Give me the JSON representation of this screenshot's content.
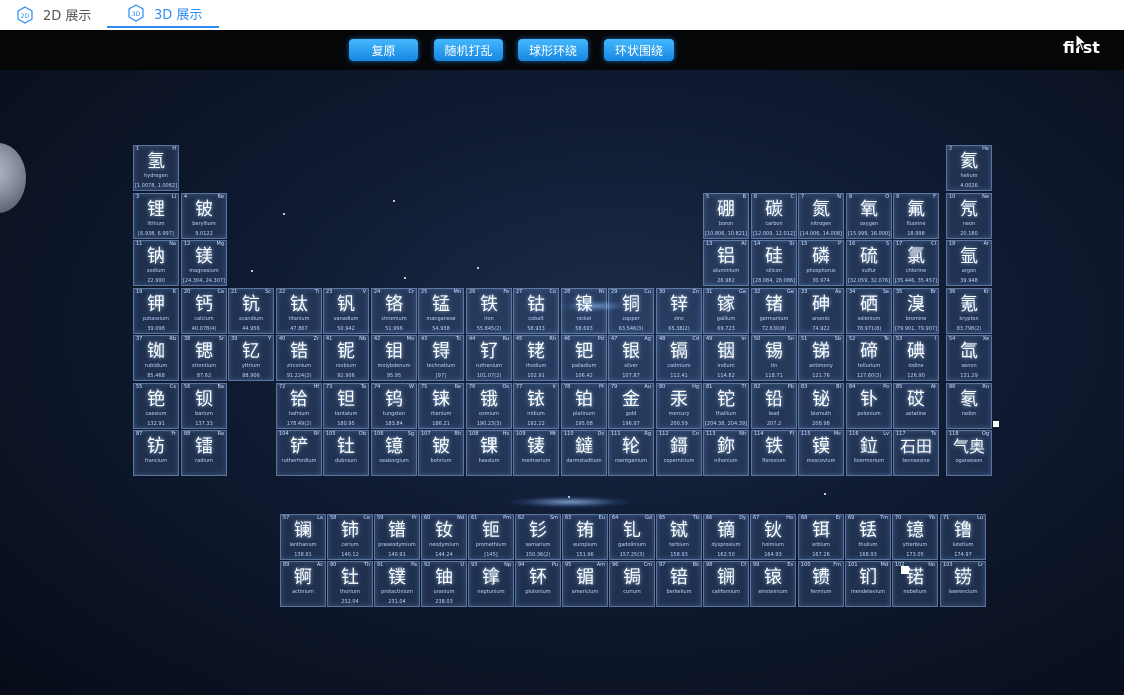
{
  "tabs": [
    {
      "label": "2D 展示",
      "icon_text": "2D",
      "icon": "cube-2d-icon"
    },
    {
      "label": "3D 展示",
      "icon_text": "3D",
      "icon": "cube-3d-icon",
      "active": true
    }
  ],
  "toolbar": {
    "buttons": [
      "复原",
      "随机打乱",
      "球形环绕",
      "环状围绕"
    ]
  },
  "scene_label": "first",
  "colors": {
    "accent": "#2d8cf0",
    "button": "#1686e0",
    "background": "#0b1426",
    "tile_border": "#a0c8ff"
  },
  "elements": [
    {
      "num": "1",
      "sym": "H",
      "name": "氢",
      "en": "hydrogen",
      "mass": "[1.0078, 1.0082]"
    },
    {
      "num": "2",
      "sym": "He",
      "name": "氦",
      "en": "helium",
      "mass": "4.0026"
    },
    {
      "num": "3",
      "sym": "Li",
      "name": "锂",
      "en": "lithium",
      "mass": "[6.938, 6.997]"
    },
    {
      "num": "4",
      "sym": "Be",
      "name": "铍",
      "en": "beryllium",
      "mass": "9.0122"
    },
    {
      "num": "5",
      "sym": "B",
      "name": "硼",
      "en": "boron",
      "mass": "[10.806, 10.821]"
    },
    {
      "num": "6",
      "sym": "C",
      "name": "碳",
      "en": "carbon",
      "mass": "[12.009, 12.012]"
    },
    {
      "num": "7",
      "sym": "N",
      "name": "氮",
      "en": "nitrogen",
      "mass": "[14.006, 14.008]"
    },
    {
      "num": "8",
      "sym": "O",
      "name": "氧",
      "en": "oxygen",
      "mass": "[15.999, 16.000]"
    },
    {
      "num": "9",
      "sym": "F",
      "name": "氟",
      "en": "fluorine",
      "mass": "18.998"
    },
    {
      "num": "10",
      "sym": "Ne",
      "name": "氖",
      "en": "neon",
      "mass": "20.180"
    },
    {
      "num": "11",
      "sym": "Na",
      "name": "钠",
      "en": "sodium",
      "mass": "22.990"
    },
    {
      "num": "12",
      "sym": "Mg",
      "name": "镁",
      "en": "magnesium",
      "mass": "[24.304, 24.307]"
    },
    {
      "num": "13",
      "sym": "Al",
      "name": "铝",
      "en": "aluminium",
      "mass": "26.982"
    },
    {
      "num": "14",
      "sym": "Si",
      "name": "硅",
      "en": "silicon",
      "mass": "[28.084, 28.086]"
    },
    {
      "num": "15",
      "sym": "P",
      "name": "磷",
      "en": "phosphorus",
      "mass": "30.974"
    },
    {
      "num": "16",
      "sym": "S",
      "name": "硫",
      "en": "sulfur",
      "mass": "[32.059, 32.076]"
    },
    {
      "num": "17",
      "sym": "Cl",
      "name": "氯",
      "en": "chlorine",
      "mass": "[35.446, 35.457]"
    },
    {
      "num": "18",
      "sym": "Ar",
      "name": "氩",
      "en": "argon",
      "mass": "39.948"
    },
    {
      "num": "19",
      "sym": "K",
      "name": "钾",
      "en": "potassium",
      "mass": "39.098"
    },
    {
      "num": "20",
      "sym": "Ca",
      "name": "钙",
      "en": "calcium",
      "mass": "40.078(4)"
    },
    {
      "num": "21",
      "sym": "Sc",
      "name": "钪",
      "en": "scandium",
      "mass": "44.956"
    },
    {
      "num": "22",
      "sym": "Ti",
      "name": "钛",
      "en": "titanium",
      "mass": "47.867"
    },
    {
      "num": "23",
      "sym": "V",
      "name": "钒",
      "en": "vanadium",
      "mass": "50.942"
    },
    {
      "num": "24",
      "sym": "Cr",
      "name": "铬",
      "en": "chromium",
      "mass": "51.996"
    },
    {
      "num": "25",
      "sym": "Mn",
      "name": "锰",
      "en": "manganese",
      "mass": "54.938"
    },
    {
      "num": "26",
      "sym": "Fe",
      "name": "铁",
      "en": "iron",
      "mass": "55.845(2)"
    },
    {
      "num": "27",
      "sym": "Co",
      "name": "钴",
      "en": "cobalt",
      "mass": "58.933"
    },
    {
      "num": "28",
      "sym": "Ni",
      "name": "镍",
      "en": "nickel",
      "mass": "58.693"
    },
    {
      "num": "29",
      "sym": "Cu",
      "name": "铜",
      "en": "copper",
      "mass": "63.546(3)"
    },
    {
      "num": "30",
      "sym": "Zn",
      "name": "锌",
      "en": "zinc",
      "mass": "65.38(2)"
    },
    {
      "num": "31",
      "sym": "Ga",
      "name": "镓",
      "en": "gallium",
      "mass": "69.723"
    },
    {
      "num": "32",
      "sym": "Ge",
      "name": "锗",
      "en": "germanium",
      "mass": "72.630(8)"
    },
    {
      "num": "33",
      "sym": "As",
      "name": "砷",
      "en": "arsenic",
      "mass": "74.922"
    },
    {
      "num": "34",
      "sym": "Se",
      "name": "硒",
      "en": "selenium",
      "mass": "78.971(8)"
    },
    {
      "num": "35",
      "sym": "Br",
      "name": "溴",
      "en": "bromine",
      "mass": "[79.901, 79.907]"
    },
    {
      "num": "36",
      "sym": "Kr",
      "name": "氪",
      "en": "krypton",
      "mass": "83.798(2)"
    },
    {
      "num": "37",
      "sym": "Rb",
      "name": "铷",
      "en": "rubidium",
      "mass": "85.468"
    },
    {
      "num": "38",
      "sym": "Sr",
      "name": "锶",
      "en": "strontium",
      "mass": "87.62"
    },
    {
      "num": "39",
      "sym": "Y",
      "name": "钇",
      "en": "yttrium",
      "mass": "88.906"
    },
    {
      "num": "40",
      "sym": "Zr",
      "name": "锆",
      "en": "zirconium",
      "mass": "91.224(2)"
    },
    {
      "num": "41",
      "sym": "Nb",
      "name": "铌",
      "en": "niobium",
      "mass": "92.906"
    },
    {
      "num": "42",
      "sym": "Mo",
      "name": "钼",
      "en": "molybdenum",
      "mass": "95.95"
    },
    {
      "num": "43",
      "sym": "Tc",
      "name": "锝",
      "en": "technetium",
      "mass": "[97]"
    },
    {
      "num": "44",
      "sym": "Ru",
      "name": "钌",
      "en": "ruthenium",
      "mass": "101.07(2)"
    },
    {
      "num": "45",
      "sym": "Rh",
      "name": "铑",
      "en": "rhodium",
      "mass": "102.91"
    },
    {
      "num": "46",
      "sym": "Pd",
      "name": "钯",
      "en": "palladium",
      "mass": "106.42"
    },
    {
      "num": "47",
      "sym": "Ag",
      "name": "银",
      "en": "silver",
      "mass": "107.87"
    },
    {
      "num": "48",
      "sym": "Cd",
      "name": "镉",
      "en": "cadmium",
      "mass": "112.41"
    },
    {
      "num": "49",
      "sym": "In",
      "name": "铟",
      "en": "indium",
      "mass": "114.82"
    },
    {
      "num": "50",
      "sym": "Sn",
      "name": "锡",
      "en": "tin",
      "mass": "118.71"
    },
    {
      "num": "51",
      "sym": "Sb",
      "name": "锑",
      "en": "antimony",
      "mass": "121.76"
    },
    {
      "num": "52",
      "sym": "Te",
      "name": "碲",
      "en": "tellurium",
      "mass": "127.60(3)"
    },
    {
      "num": "53",
      "sym": "I",
      "name": "碘",
      "en": "iodine",
      "mass": "126.90"
    },
    {
      "num": "54",
      "sym": "Xe",
      "name": "氙",
      "en": "xenon",
      "mass": "131.29"
    },
    {
      "num": "55",
      "sym": "Cs",
      "name": "铯",
      "en": "caesium",
      "mass": "132.91"
    },
    {
      "num": "56",
      "sym": "Ba",
      "name": "钡",
      "en": "barium",
      "mass": "137.33"
    },
    {
      "num": "72",
      "sym": "Hf",
      "name": "铪",
      "en": "hafnium",
      "mass": "178.49(2)"
    },
    {
      "num": "73",
      "sym": "Ta",
      "name": "钽",
      "en": "tantalum",
      "mass": "180.95"
    },
    {
      "num": "74",
      "sym": "W",
      "name": "钨",
      "en": "tungsten",
      "mass": "183.84"
    },
    {
      "num": "75",
      "sym": "Re",
      "name": "铼",
      "en": "rhenium",
      "mass": "186.21"
    },
    {
      "num": "76",
      "sym": "Os",
      "name": "锇",
      "en": "osmium",
      "mass": "190.23(3)"
    },
    {
      "num": "77",
      "sym": "Ir",
      "name": "铱",
      "en": "iridium",
      "mass": "192.22"
    },
    {
      "num": "78",
      "sym": "Pt",
      "name": "铂",
      "en": "platinum",
      "mass": "195.08"
    },
    {
      "num": "79",
      "sym": "Au",
      "name": "金",
      "en": "gold",
      "mass": "196.97"
    },
    {
      "num": "80",
      "sym": "Hg",
      "name": "汞",
      "en": "mercury",
      "mass": "200.59"
    },
    {
      "num": "81",
      "sym": "Tl",
      "name": "铊",
      "en": "thallium",
      "mass": "[204.38, 204.39]"
    },
    {
      "num": "82",
      "sym": "Pb",
      "name": "铅",
      "en": "lead",
      "mass": "207.2"
    },
    {
      "num": "83",
      "sym": "Bi",
      "name": "铋",
      "en": "bismuth",
      "mass": "208.98"
    },
    {
      "num": "84",
      "sym": "Po",
      "name": "钋",
      "en": "polonium",
      "mass": ""
    },
    {
      "num": "85",
      "sym": "At",
      "name": "砹",
      "en": "astatine",
      "mass": ""
    },
    {
      "num": "86",
      "sym": "Rn",
      "name": "氡",
      "en": "radon",
      "mass": ""
    },
    {
      "num": "87",
      "sym": "Fr",
      "name": "钫",
      "en": "francium",
      "mass": ""
    },
    {
      "num": "88",
      "sym": "Ra",
      "name": "镭",
      "en": "radium",
      "mass": ""
    },
    {
      "num": "104",
      "sym": "Rf",
      "name": "铲",
      "en": "rutherfordium",
      "mass": ""
    },
    {
      "num": "105",
      "sym": "Db",
      "name": "钍",
      "en": "dubnium",
      "mass": ""
    },
    {
      "num": "106",
      "sym": "Sg",
      "name": "镱",
      "en": "seaborgium",
      "mass": ""
    },
    {
      "num": "107",
      "sym": "Bh",
      "name": "铍",
      "en": "bohrium",
      "mass": ""
    },
    {
      "num": "108",
      "sym": "Hs",
      "name": "锞",
      "en": "hassium",
      "mass": ""
    },
    {
      "num": "109",
      "sym": "Mt",
      "name": "鿏",
      "en": "meitnerium",
      "mass": ""
    },
    {
      "num": "110",
      "sym": "Ds",
      "name": "鐽",
      "en": "darmstadtium",
      "mass": ""
    },
    {
      "num": "111",
      "sym": "Rg",
      "name": "轮",
      "en": "roentgenium",
      "mass": ""
    },
    {
      "num": "112",
      "sym": "Cn",
      "name": "鎶",
      "en": "copernicium",
      "mass": ""
    },
    {
      "num": "113",
      "sym": "Nh",
      "name": "鉨",
      "en": "nihonium",
      "mass": ""
    },
    {
      "num": "114",
      "sym": "Fl",
      "name": "铁",
      "en": "flerovium",
      "mass": ""
    },
    {
      "num": "115",
      "sym": "Mc",
      "name": "镆",
      "en": "moscovium",
      "mass": ""
    },
    {
      "num": "116",
      "sym": "Lv",
      "name": "鉝",
      "en": "livermorium",
      "mass": ""
    },
    {
      "num": "117",
      "sym": "Ts",
      "name": "石田",
      "en": "tennessine",
      "mass": ""
    },
    {
      "num": "118",
      "sym": "Og",
      "name": "气奥",
      "en": "oganesson",
      "mass": ""
    },
    {
      "num": "57",
      "sym": "La",
      "name": "镧",
      "en": "lanthanum",
      "mass": "138.91"
    },
    {
      "num": "58",
      "sym": "Ce",
      "name": "铈",
      "en": "cerium",
      "mass": "140.12"
    },
    {
      "num": "59",
      "sym": "Pr",
      "name": "镨",
      "en": "praseodymium",
      "mass": "140.91"
    },
    {
      "num": "60",
      "sym": "Nd",
      "name": "钕",
      "en": "neodymium",
      "mass": "144.24"
    },
    {
      "num": "61",
      "sym": "Pm",
      "name": "钷",
      "en": "promethium",
      "mass": "[145]"
    },
    {
      "num": "62",
      "sym": "Sm",
      "name": "钐",
      "en": "samarium",
      "mass": "150.36(2)"
    },
    {
      "num": "63",
      "sym": "Eu",
      "name": "铕",
      "en": "europium",
      "mass": "151.96"
    },
    {
      "num": "64",
      "sym": "Gd",
      "name": "钆",
      "en": "gadolinium",
      "mass": "157.25(3)"
    },
    {
      "num": "65",
      "sym": "Tb",
      "name": "铽",
      "en": "terbium",
      "mass": "158.93"
    },
    {
      "num": "66",
      "sym": "Dy",
      "name": "镝",
      "en": "dysprosium",
      "mass": "162.50"
    },
    {
      "num": "67",
      "sym": "Ho",
      "name": "钬",
      "en": "holmium",
      "mass": "164.93"
    },
    {
      "num": "68",
      "sym": "Er",
      "name": "铒",
      "en": "erbium",
      "mass": "167.26"
    },
    {
      "num": "69",
      "sym": "Tm",
      "name": "铥",
      "en": "thulium",
      "mass": "168.93"
    },
    {
      "num": "70",
      "sym": "Yb",
      "name": "镱",
      "en": "ytterbium",
      "mass": "173.05"
    },
    {
      "num": "71",
      "sym": "Lu",
      "name": "镥",
      "en": "lutetium",
      "mass": "174.97"
    },
    {
      "num": "89",
      "sym": "Ac",
      "name": "锕",
      "en": "actinium",
      "mass": ""
    },
    {
      "num": "90",
      "sym": "Th",
      "name": "钍",
      "en": "thorium",
      "mass": "232.04"
    },
    {
      "num": "91",
      "sym": "Pa",
      "name": "镤",
      "en": "protactinium",
      "mass": "231.04"
    },
    {
      "num": "92",
      "sym": "U",
      "name": "铀",
      "en": "uranium",
      "mass": "238.03"
    },
    {
      "num": "93",
      "sym": "Np",
      "name": "镎",
      "en": "neptunium",
      "mass": ""
    },
    {
      "num": "94",
      "sym": "Pu",
      "name": "钚",
      "en": "plutonium",
      "mass": ""
    },
    {
      "num": "95",
      "sym": "Am",
      "name": "镅",
      "en": "americium",
      "mass": ""
    },
    {
      "num": "96",
      "sym": "Cm",
      "name": "锔",
      "en": "curium",
      "mass": ""
    },
    {
      "num": "97",
      "sym": "Bk",
      "name": "锫",
      "en": "berkelium",
      "mass": ""
    },
    {
      "num": "98",
      "sym": "Cf",
      "name": "锎",
      "en": "californium",
      "mass": ""
    },
    {
      "num": "99",
      "sym": "Es",
      "name": "锿",
      "en": "einsteinium",
      "mass": ""
    },
    {
      "num": "100",
      "sym": "Fm",
      "name": "镄",
      "en": "fermium",
      "mass": ""
    },
    {
      "num": "101",
      "sym": "Md",
      "name": "钔",
      "en": "mendelevium",
      "mass": ""
    },
    {
      "num": "102",
      "sym": "No",
      "name": "锘",
      "en": "nobelium",
      "mass": ""
    },
    {
      "num": "103",
      "sym": "Lr",
      "name": "铹",
      "en": "lawrencium",
      "mass": ""
    }
  ]
}
